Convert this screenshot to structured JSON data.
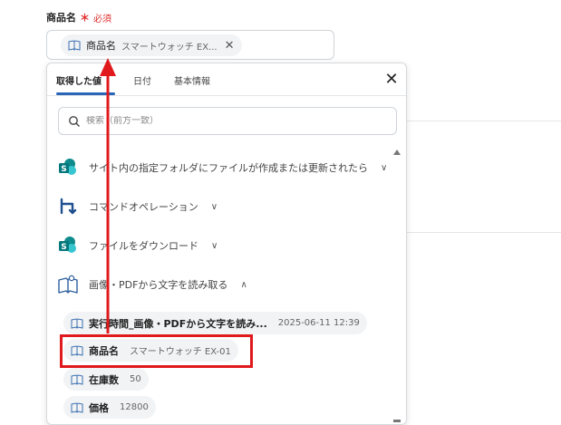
{
  "field": {
    "label": "商品名",
    "required_mark": "＊",
    "required_text": "必須",
    "chip": {
      "label": "商品名",
      "value": "スマートウォッチ EX...",
      "close": "✕"
    }
  },
  "panel": {
    "tabs": [
      {
        "label": "取得した値"
      },
      {
        "label": "日付"
      },
      {
        "label": "基本情報"
      }
    ],
    "close": "✕",
    "search": {
      "placeholder": "検索（前方一致）"
    },
    "groups": [
      {
        "label": "サイト内の指定フォルダにファイルが作成または更新されたら",
        "chevron": "∨",
        "icon": "sharepoint-icon"
      },
      {
        "label": "コマンドオペレーション",
        "chevron": "∨",
        "icon": "command-operation-icon"
      },
      {
        "label": "ファイルをダウンロード",
        "chevron": "∨",
        "icon": "sharepoint-icon"
      },
      {
        "label": "画像・PDFから文字を読み取る",
        "chevron": "∧",
        "icon": "ocr-book-icon"
      }
    ],
    "items": [
      {
        "label": "実行時間_画像・PDFから文字を読み...",
        "value": "2025-06-11 12:39"
      },
      {
        "label": "商品名",
        "value": "スマートウォッチ EX-01"
      },
      {
        "label": "在庫数",
        "value": "50"
      },
      {
        "label": "価格",
        "value": "12800"
      }
    ]
  },
  "colors": {
    "accent": "#2a66b8",
    "annotation_red": "#e0191c",
    "required": "#e02d2d",
    "sharepoint": "#03787c"
  }
}
